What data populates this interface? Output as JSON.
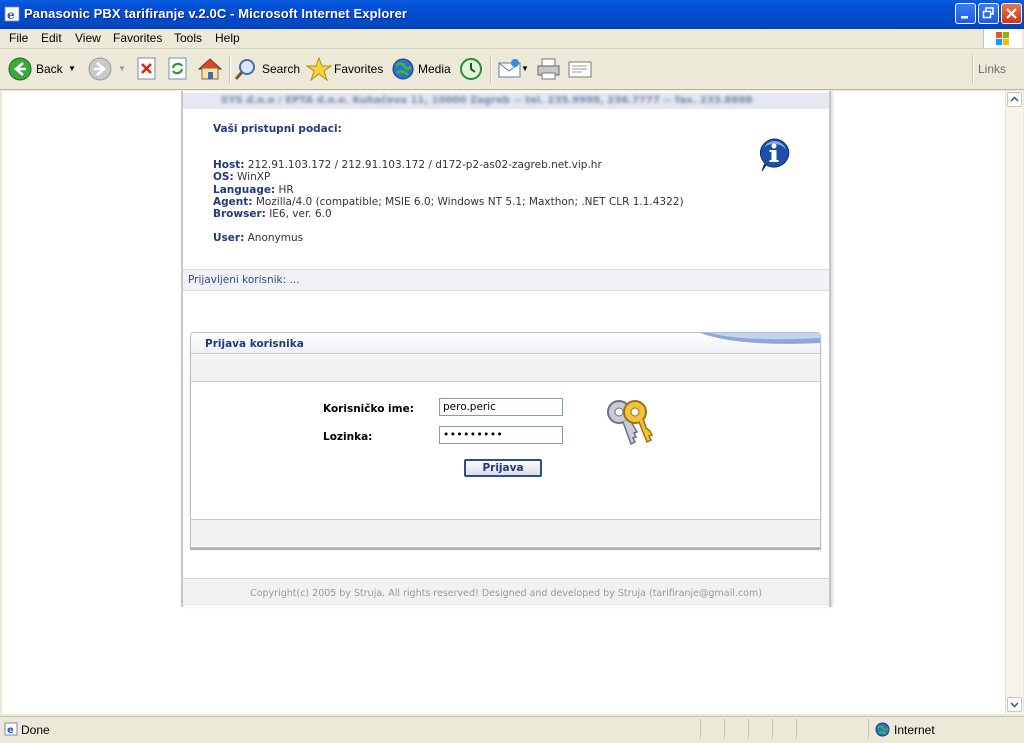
{
  "window": {
    "title": "Panasonic PBX tarifiranje v.2.0C - Microsoft Internet Explorer"
  },
  "menu": [
    "File",
    "Edit",
    "View",
    "Favorites",
    "Tools",
    "Help"
  ],
  "toolbar": {
    "back_label": "Back",
    "search_label": "Search",
    "favorites_label": "Favorites",
    "media_label": "Media",
    "links_label": "Links"
  },
  "page": {
    "header_text": "SYS d.o.o / EPTA d.o.o. Kuhačeva 11, 10000 Zagreb -- tel. 235.9999, 236.7777 -- fax. 233.8888",
    "info": {
      "heading": "Vaši pristupni podaci:",
      "host_label": "Host:",
      "host_value": "212.91.103.172 / 212.91.103.172 / d172-p2-as02-zagreb.net.vip.hr",
      "os_label": "OS:",
      "os_value": "WinXP",
      "language_label": "Language:",
      "language_value": "HR",
      "agent_label": "Agent:",
      "agent_value": "Mozilla/4.0 (compatible; MSIE 6.0; Windows NT 5.1; Maxthon; .NET CLR 1.1.4322)",
      "browser_label": "Browser:",
      "browser_value": "IE6, ver. 6.0",
      "user_label": "User:",
      "user_value": "Anonymus"
    },
    "logged_in_text": "Prijavljeni korisnik: ...",
    "login": {
      "title": "Prijava korisnika",
      "username_label": "Korisničko ime:",
      "username_value": "pero.peric",
      "password_label": "Lozinka:",
      "password_value": "•••••••••",
      "submit_label": "Prijava"
    },
    "footer": "Copyright(c) 2005 by Struja. All rights reserved! Designed and developed by Struja (tarifiranje@gmail.com)"
  },
  "status": {
    "text": "Done",
    "zone": "Internet"
  }
}
